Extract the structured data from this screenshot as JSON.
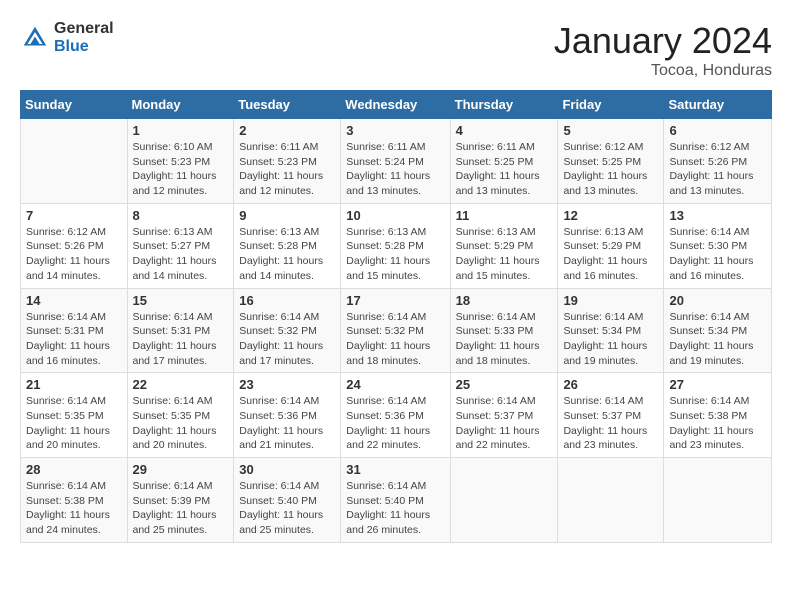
{
  "header": {
    "logo_general": "General",
    "logo_blue": "Blue",
    "month": "January 2024",
    "location": "Tocoa, Honduras"
  },
  "days_of_week": [
    "Sunday",
    "Monday",
    "Tuesday",
    "Wednesday",
    "Thursday",
    "Friday",
    "Saturday"
  ],
  "weeks": [
    [
      {
        "num": "",
        "info": ""
      },
      {
        "num": "1",
        "info": "Sunrise: 6:10 AM\nSunset: 5:23 PM\nDaylight: 11 hours\nand 12 minutes."
      },
      {
        "num": "2",
        "info": "Sunrise: 6:11 AM\nSunset: 5:23 PM\nDaylight: 11 hours\nand 12 minutes."
      },
      {
        "num": "3",
        "info": "Sunrise: 6:11 AM\nSunset: 5:24 PM\nDaylight: 11 hours\nand 13 minutes."
      },
      {
        "num": "4",
        "info": "Sunrise: 6:11 AM\nSunset: 5:25 PM\nDaylight: 11 hours\nand 13 minutes."
      },
      {
        "num": "5",
        "info": "Sunrise: 6:12 AM\nSunset: 5:25 PM\nDaylight: 11 hours\nand 13 minutes."
      },
      {
        "num": "6",
        "info": "Sunrise: 6:12 AM\nSunset: 5:26 PM\nDaylight: 11 hours\nand 13 minutes."
      }
    ],
    [
      {
        "num": "7",
        "info": "Sunrise: 6:12 AM\nSunset: 5:26 PM\nDaylight: 11 hours\nand 14 minutes."
      },
      {
        "num": "8",
        "info": "Sunrise: 6:13 AM\nSunset: 5:27 PM\nDaylight: 11 hours\nand 14 minutes."
      },
      {
        "num": "9",
        "info": "Sunrise: 6:13 AM\nSunset: 5:28 PM\nDaylight: 11 hours\nand 14 minutes."
      },
      {
        "num": "10",
        "info": "Sunrise: 6:13 AM\nSunset: 5:28 PM\nDaylight: 11 hours\nand 15 minutes."
      },
      {
        "num": "11",
        "info": "Sunrise: 6:13 AM\nSunset: 5:29 PM\nDaylight: 11 hours\nand 15 minutes."
      },
      {
        "num": "12",
        "info": "Sunrise: 6:13 AM\nSunset: 5:29 PM\nDaylight: 11 hours\nand 16 minutes."
      },
      {
        "num": "13",
        "info": "Sunrise: 6:14 AM\nSunset: 5:30 PM\nDaylight: 11 hours\nand 16 minutes."
      }
    ],
    [
      {
        "num": "14",
        "info": "Sunrise: 6:14 AM\nSunset: 5:31 PM\nDaylight: 11 hours\nand 16 minutes."
      },
      {
        "num": "15",
        "info": "Sunrise: 6:14 AM\nSunset: 5:31 PM\nDaylight: 11 hours\nand 17 minutes."
      },
      {
        "num": "16",
        "info": "Sunrise: 6:14 AM\nSunset: 5:32 PM\nDaylight: 11 hours\nand 17 minutes."
      },
      {
        "num": "17",
        "info": "Sunrise: 6:14 AM\nSunset: 5:32 PM\nDaylight: 11 hours\nand 18 minutes."
      },
      {
        "num": "18",
        "info": "Sunrise: 6:14 AM\nSunset: 5:33 PM\nDaylight: 11 hours\nand 18 minutes."
      },
      {
        "num": "19",
        "info": "Sunrise: 6:14 AM\nSunset: 5:34 PM\nDaylight: 11 hours\nand 19 minutes."
      },
      {
        "num": "20",
        "info": "Sunrise: 6:14 AM\nSunset: 5:34 PM\nDaylight: 11 hours\nand 19 minutes."
      }
    ],
    [
      {
        "num": "21",
        "info": "Sunrise: 6:14 AM\nSunset: 5:35 PM\nDaylight: 11 hours\nand 20 minutes."
      },
      {
        "num": "22",
        "info": "Sunrise: 6:14 AM\nSunset: 5:35 PM\nDaylight: 11 hours\nand 20 minutes."
      },
      {
        "num": "23",
        "info": "Sunrise: 6:14 AM\nSunset: 5:36 PM\nDaylight: 11 hours\nand 21 minutes."
      },
      {
        "num": "24",
        "info": "Sunrise: 6:14 AM\nSunset: 5:36 PM\nDaylight: 11 hours\nand 22 minutes."
      },
      {
        "num": "25",
        "info": "Sunrise: 6:14 AM\nSunset: 5:37 PM\nDaylight: 11 hours\nand 22 minutes."
      },
      {
        "num": "26",
        "info": "Sunrise: 6:14 AM\nSunset: 5:37 PM\nDaylight: 11 hours\nand 23 minutes."
      },
      {
        "num": "27",
        "info": "Sunrise: 6:14 AM\nSunset: 5:38 PM\nDaylight: 11 hours\nand 23 minutes."
      }
    ],
    [
      {
        "num": "28",
        "info": "Sunrise: 6:14 AM\nSunset: 5:38 PM\nDaylight: 11 hours\nand 24 minutes."
      },
      {
        "num": "29",
        "info": "Sunrise: 6:14 AM\nSunset: 5:39 PM\nDaylight: 11 hours\nand 25 minutes."
      },
      {
        "num": "30",
        "info": "Sunrise: 6:14 AM\nSunset: 5:40 PM\nDaylight: 11 hours\nand 25 minutes."
      },
      {
        "num": "31",
        "info": "Sunrise: 6:14 AM\nSunset: 5:40 PM\nDaylight: 11 hours\nand 26 minutes."
      },
      {
        "num": "",
        "info": ""
      },
      {
        "num": "",
        "info": ""
      },
      {
        "num": "",
        "info": ""
      }
    ]
  ]
}
